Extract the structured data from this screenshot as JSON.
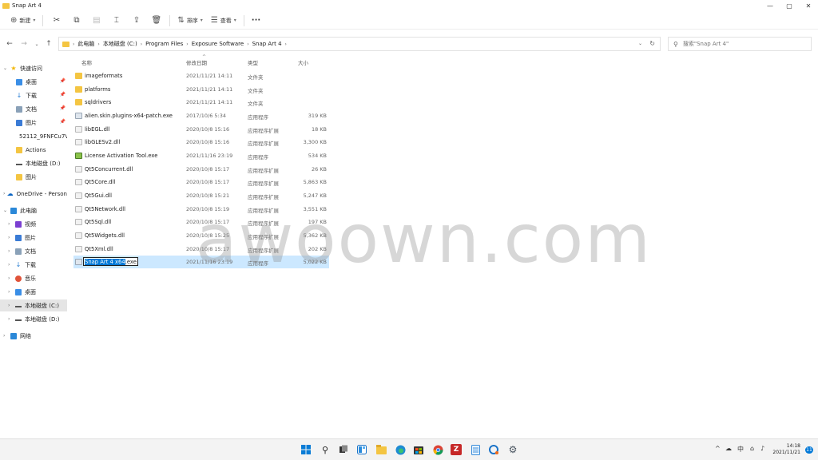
{
  "window": {
    "title": "Snap Art 4",
    "minimize": "—",
    "maximize": "▢",
    "close": "✕"
  },
  "toolbar": {
    "new_label": "新建",
    "sort_label": "排序",
    "view_label": "查看",
    "more_label": "···"
  },
  "address": {
    "crumbs": [
      "此电脑",
      "本地磁盘 (C:)",
      "Program Files",
      "Exposure Software",
      "Snap Art 4"
    ]
  },
  "search": {
    "placeholder": "搜索\"Snap Art 4\""
  },
  "sidebar": {
    "items": [
      {
        "label": "快速访问",
        "icon": "star-icon"
      },
      {
        "label": "桌面",
        "icon": "desktop-icon"
      },
      {
        "label": "下载",
        "icon": "download-icon"
      },
      {
        "label": "文档",
        "icon": "document-icon"
      },
      {
        "label": "图片",
        "icon": "picture-icon"
      },
      {
        "label": "52112_9FNFCu7V",
        "icon": "folder-icon"
      },
      {
        "label": "Actions",
        "icon": "folder-icon"
      },
      {
        "label": "本地磁盘 (D:)",
        "icon": "drive-icon"
      },
      {
        "label": "图片",
        "icon": "folder-icon"
      },
      {
        "label": "OneDrive - Person",
        "icon": "cloud-icon"
      },
      {
        "label": "此电脑",
        "icon": "computer-icon"
      },
      {
        "label": "视频",
        "icon": "video-icon"
      },
      {
        "label": "图片",
        "icon": "picture-icon"
      },
      {
        "label": "文档",
        "icon": "document-icon"
      },
      {
        "label": "下载",
        "icon": "download-icon"
      },
      {
        "label": "音乐",
        "icon": "music-icon"
      },
      {
        "label": "桌面",
        "icon": "desktop-icon"
      },
      {
        "label": "本地磁盘 (C:)",
        "icon": "drive-icon"
      },
      {
        "label": "本地磁盘 (D:)",
        "icon": "drive-icon"
      },
      {
        "label": "网络",
        "icon": "network-icon"
      }
    ]
  },
  "columns": {
    "name": "名称",
    "date": "修改日期",
    "type": "类型",
    "size": "大小"
  },
  "files": [
    {
      "name": "imageformats",
      "date": "2021/11/21 14:11",
      "type": "文件夹",
      "size": "",
      "kind": "folder"
    },
    {
      "name": "platforms",
      "date": "2021/11/21 14:11",
      "type": "文件夹",
      "size": "",
      "kind": "folder"
    },
    {
      "name": "sqldrivers",
      "date": "2021/11/21 14:11",
      "type": "文件夹",
      "size": "",
      "kind": "folder"
    },
    {
      "name": "alien.skin.plugins-x64-patch.exe",
      "date": "2017/10/6 5:34",
      "type": "应用程序",
      "size": "319 KB",
      "kind": "exe"
    },
    {
      "name": "libEGL.dll",
      "date": "2020/10/8 15:16",
      "type": "应用程序扩展",
      "size": "18 KB",
      "kind": "dll"
    },
    {
      "name": "libGLESv2.dll",
      "date": "2020/10/8 15:16",
      "type": "应用程序扩展",
      "size": "3,300 KB",
      "kind": "dll"
    },
    {
      "name": "License Activation Tool.exe",
      "date": "2021/11/16 23:19",
      "type": "应用程序",
      "size": "534 KB",
      "kind": "app"
    },
    {
      "name": "Qt5Concurrent.dll",
      "date": "2020/10/8 15:17",
      "type": "应用程序扩展",
      "size": "26 KB",
      "kind": "dll"
    },
    {
      "name": "Qt5Core.dll",
      "date": "2020/10/8 15:17",
      "type": "应用程序扩展",
      "size": "5,863 KB",
      "kind": "dll"
    },
    {
      "name": "Qt5Gui.dll",
      "date": "2020/10/8 15:21",
      "type": "应用程序扩展",
      "size": "5,247 KB",
      "kind": "dll"
    },
    {
      "name": "Qt5Network.dll",
      "date": "2020/10/8 15:19",
      "type": "应用程序扩展",
      "size": "3,551 KB",
      "kind": "dll"
    },
    {
      "name": "Qt5Sql.dll",
      "date": "2020/10/8 15:17",
      "type": "应用程序扩展",
      "size": "197 KB",
      "kind": "dll"
    },
    {
      "name": "Qt5Widgets.dll",
      "date": "2020/10/8 15:25",
      "type": "应用程序扩展",
      "size": "5,362 KB",
      "kind": "dll"
    },
    {
      "name": "Qt5Xml.dll",
      "date": "2020/10/8 15:17",
      "type": "应用程序扩展",
      "size": "202 KB",
      "kind": "dll"
    },
    {
      "name": "Snap Art 4 x64.exe",
      "name_selected": "Snap Art 4 x64",
      "name_ext": ".exe",
      "date": "2021/11/16 23:19",
      "type": "应用程序",
      "size": "5,022 KB",
      "kind": "exe",
      "selected": true
    }
  ],
  "watermark": "awoown.com",
  "taskbar": {
    "apps": [
      "windows-start-icon",
      "search-icon",
      "task-view-icon",
      "widgets-icon",
      "file-explorer-icon",
      "edge-icon",
      "store-icon",
      "chrome-icon",
      "filezilla-icon",
      "notepad-icon",
      "snipping-icon",
      "settings-icon"
    ],
    "tray": {
      "chevron": "^",
      "ime": "中",
      "clock_time": "14:18",
      "clock_date": "2021/11/21",
      "notification_count": "11"
    }
  },
  "colors": {
    "selection": "#cce8ff",
    "accent": "#0078d7",
    "folder": "#f4c542"
  }
}
